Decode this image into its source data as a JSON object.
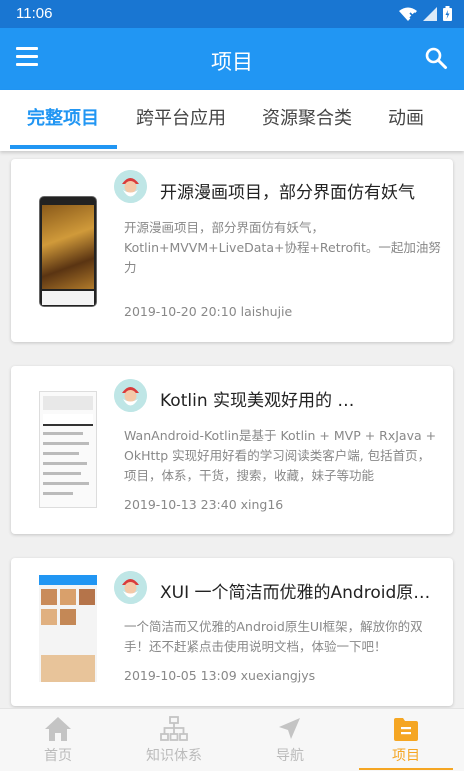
{
  "status_bar": {
    "time": "11:06"
  },
  "app_bar": {
    "title": "项目"
  },
  "tabs": [
    {
      "label": "完整项目",
      "active": true
    },
    {
      "label": "跨平台应用",
      "active": false
    },
    {
      "label": "资源聚合类",
      "active": false
    },
    {
      "label": "动画",
      "active": false
    }
  ],
  "cards": [
    {
      "title": "开源漫画项目，部分界面仿有妖气",
      "description": "开源漫画项目，部分界面仿有妖气，Kotlin+MVVM+LiveData+协程+Retrofit。一起加油努力",
      "date": "2019-10-20 20:10",
      "author": "laishujie"
    },
    {
      "title": "Kotlin 实现美观好用的 …",
      "description": "WanAndroid-Kotlin是基于 Kotlin + MVP + RxJava + OkHttp 实现好用好看的学习阅读类客户端, 包括首页，项目，体系，干货，搜索，收藏，妹子等功能",
      "date": "2019-10-13 23:40",
      "author": "xing16"
    },
    {
      "title": "XUI 一个简洁而优雅的Android原生UI框架",
      "description": "一个简洁而又优雅的Android原生UI框架，解放你的双手！还不赶紧点击使用说明文档，体验一下吧！",
      "date": "2019-10-05 13:09",
      "author": "xuexiangjys"
    }
  ],
  "bottom_nav": [
    {
      "label": "首页",
      "icon": "home-icon",
      "active": false
    },
    {
      "label": "知识体系",
      "icon": "hierarchy-icon",
      "active": false
    },
    {
      "label": "导航",
      "icon": "navigation-arrow-icon",
      "active": false
    },
    {
      "label": "项目",
      "icon": "project-icon",
      "active": true
    }
  ],
  "colors": {
    "primary": "#2196f3",
    "status_bar": "#1976d2",
    "nav_active": "#f5a623",
    "nav_inactive": "#bbbbbb"
  }
}
